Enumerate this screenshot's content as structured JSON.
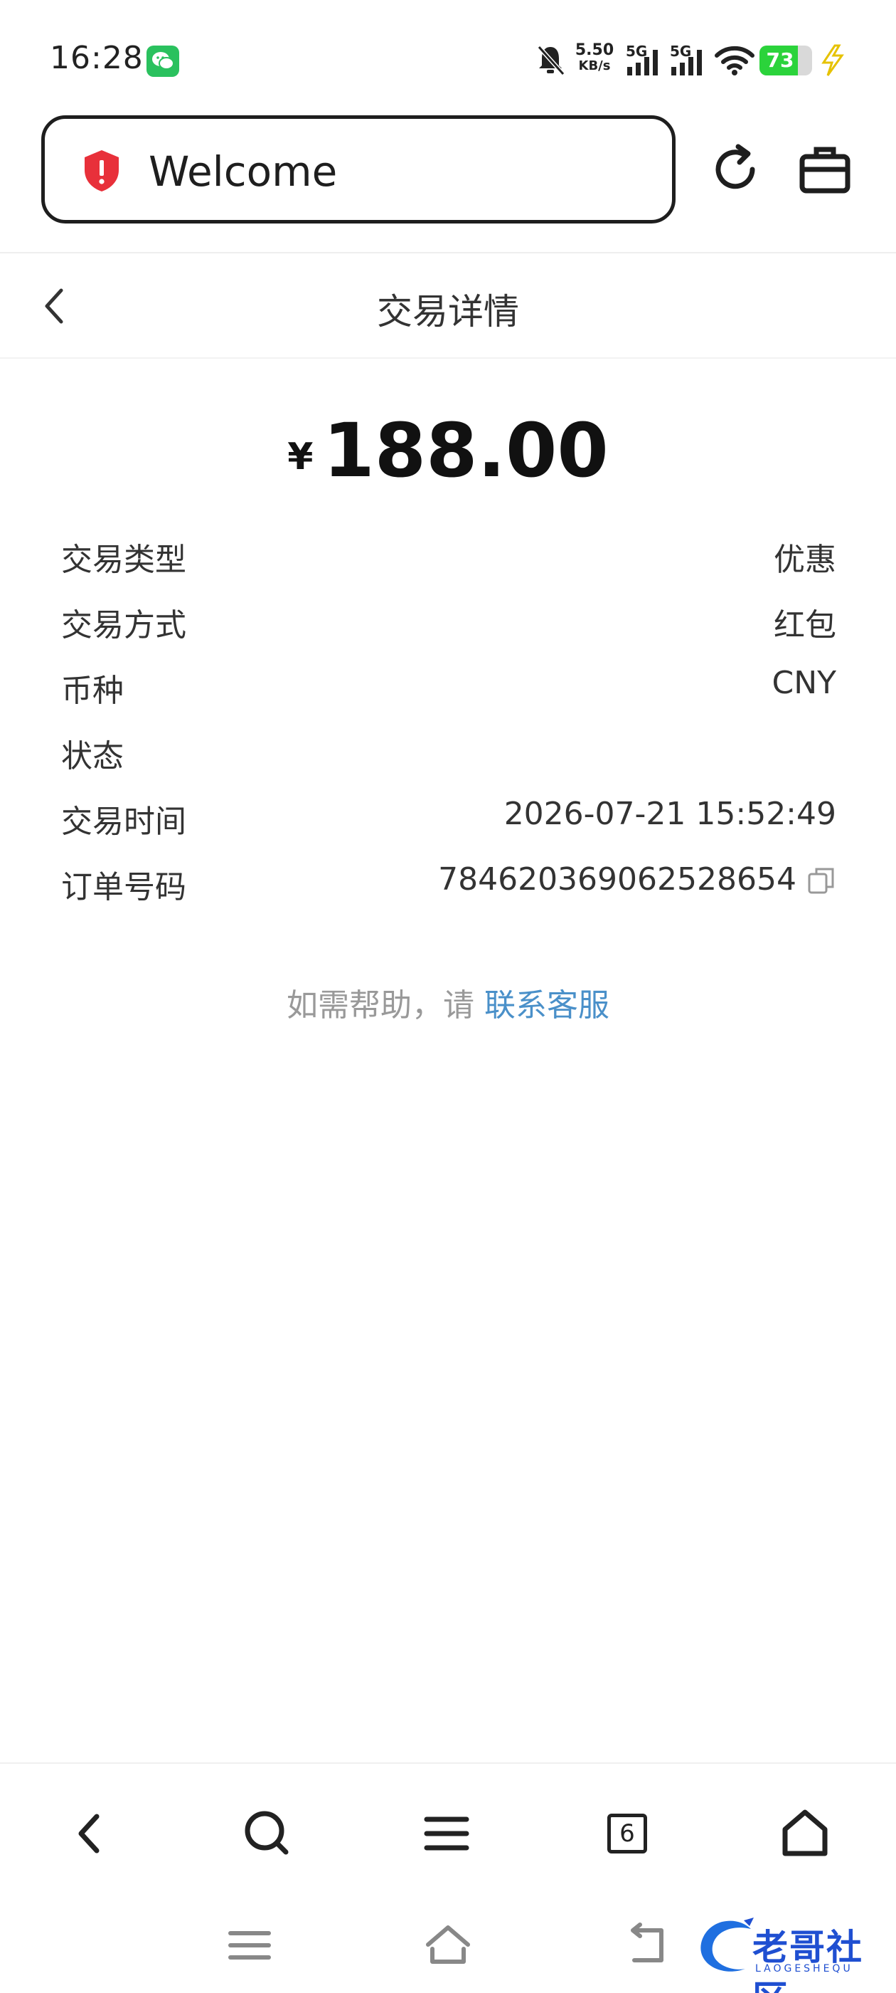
{
  "status_bar": {
    "time": "16:28",
    "net_speed_value": "5.50",
    "net_speed_unit": "KB/s",
    "sim1": "5G",
    "sim2": "5G",
    "battery": "73",
    "battery_level": 0.73
  },
  "browser": {
    "url_text": "Welcome"
  },
  "header": {
    "title": "交易详情"
  },
  "amount": {
    "currency": "¥",
    "value": "188.00"
  },
  "details": [
    {
      "label": "交易类型",
      "value": "优惠"
    },
    {
      "label": "交易方式",
      "value": "红包"
    },
    {
      "label": "币种",
      "value": "CNY"
    },
    {
      "label": "状态",
      "value": ""
    },
    {
      "label": "交易时间",
      "value": "2026-07-21 15:52:49"
    },
    {
      "label": "订单号码",
      "value": "784620369062528654"
    }
  ],
  "help": {
    "text": "如需帮助，请",
    "link": "联系客服"
  },
  "bottom_nav": {
    "tabs_count": "6"
  },
  "watermark": {
    "text": "老哥社区",
    "sub": "LAOGESHEQU"
  },
  "colors": {
    "link": "#4a90c9",
    "shield": "#e8303a",
    "battery": "#2bd33b",
    "wechat": "#2ac15e"
  }
}
